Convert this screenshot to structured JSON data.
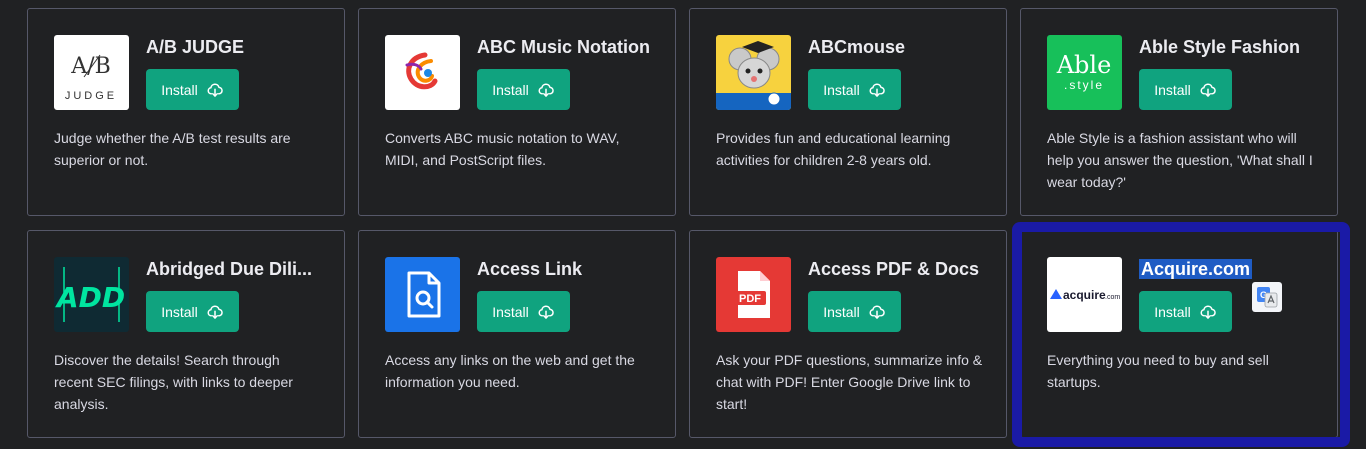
{
  "plugins": [
    {
      "name": "A/B JUDGE",
      "install_label": "Install",
      "description": "Judge whether the A/B test results are superior or not.",
      "logo": {
        "icon": "ab-judge-logo",
        "bg": "#ffffff",
        "line1": "A/B",
        "line2": "JUDGE"
      }
    },
    {
      "name": "ABC Music Notation",
      "install_label": "Install",
      "description": "Converts ABC music notation to WAV, MIDI, and PostScript files.",
      "logo": {
        "icon": "abc-music-swirl-logo",
        "bg": "#ffffff"
      }
    },
    {
      "name": "ABCmouse",
      "install_label": "Install",
      "description": "Provides fun and educational learning activities for children 2-8 years old.",
      "logo": {
        "icon": "abcmouse-mouse-logo",
        "bg": "#f7d23e"
      }
    },
    {
      "name": "Able Style Fashion",
      "install_label": "Install",
      "description": "Able Style is a fashion assistant who will help you answer the question, 'What shall I wear today?'",
      "logo": {
        "icon": "able-style-logo",
        "bg": "#17c05a",
        "line1": "Able",
        "line2": ".style"
      }
    },
    {
      "name": "Abridged Due Dili...",
      "install_label": "Install",
      "description": "Discover the details! Search through recent SEC filings, with links to deeper analysis.",
      "logo": {
        "icon": "add-logo",
        "bg": "#0f2a33",
        "line1": "ADD"
      }
    },
    {
      "name": "Access Link",
      "install_label": "Install",
      "description": "Access any links on the web and get the information you need.",
      "logo": {
        "icon": "document-search-icon",
        "bg": "#1a73e8"
      }
    },
    {
      "name": "Access PDF & Docs",
      "install_label": "Install",
      "description": "Ask your PDF questions, summarize info & chat with PDF! Enter Google Drive link to start!",
      "logo": {
        "icon": "pdf-file-icon",
        "bg": "#e53935",
        "line1": "PDF"
      }
    },
    {
      "name": "Acquire.com",
      "install_label": "Install",
      "description": "Everything you need to buy and sell startups.",
      "logo": {
        "icon": "acquire-logo",
        "bg": "#ffffff",
        "line1": "acquire",
        "line2": ".com"
      }
    }
  ],
  "colors": {
    "background": "#202123",
    "card_border": "#565869",
    "install_button": "#10a37f",
    "highlight_frame": "#1a1aa6",
    "text_selection": "#1f5cc4"
  },
  "overlay": {
    "translate_icon": "google-translate-icon"
  }
}
